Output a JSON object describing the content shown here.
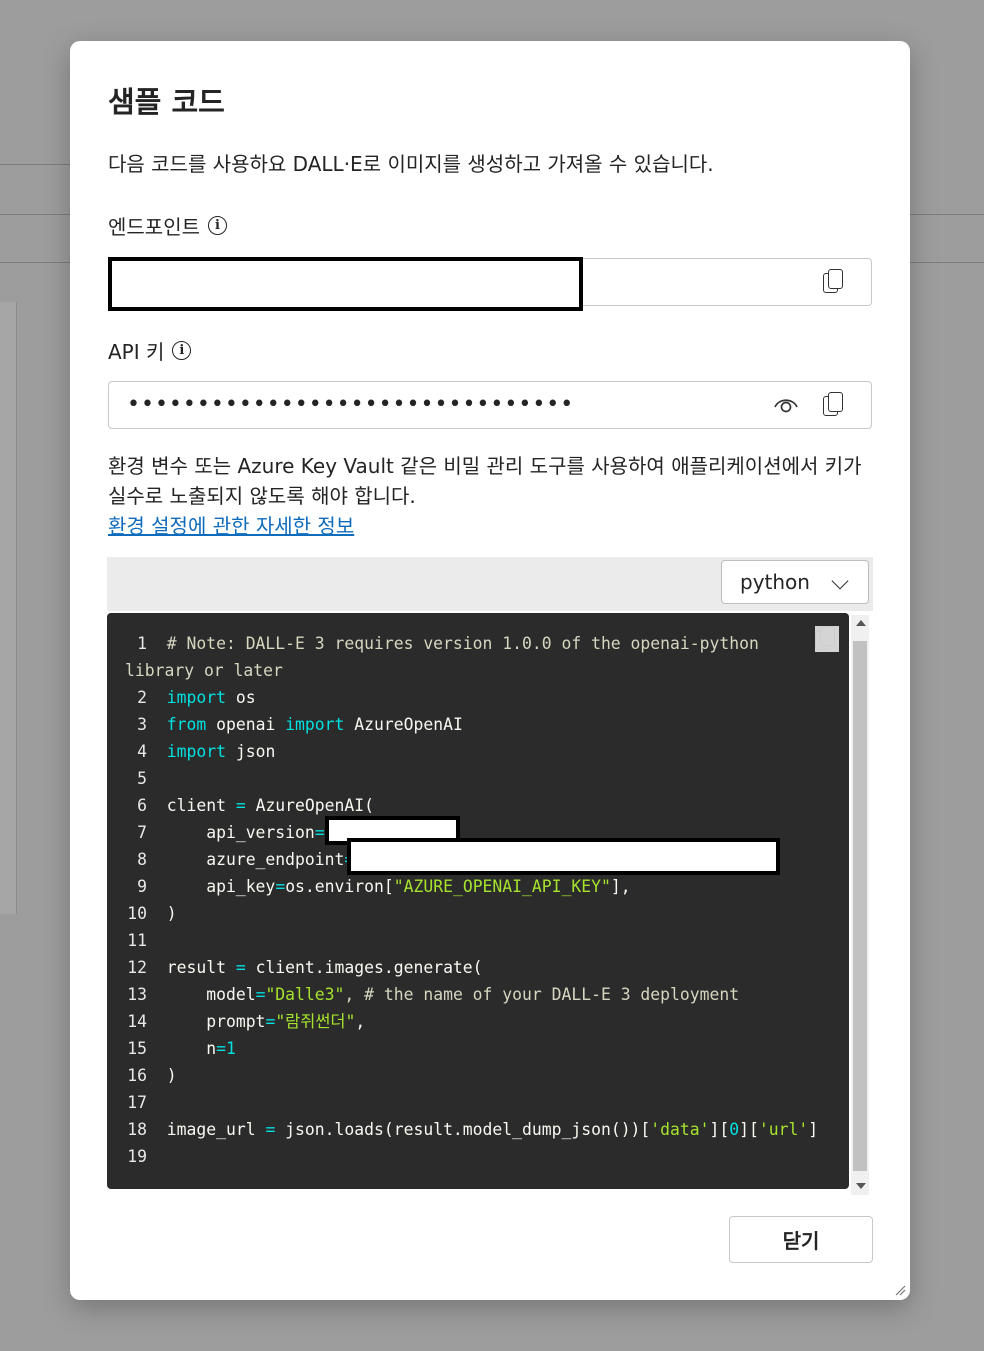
{
  "dialog": {
    "title": "샘플 코드",
    "description": "다음 코드를 사용하요 DALL·E로 이미지를 생성하고 가져올 수 있습니다.",
    "endpoint_label": "엔드포인트",
    "api_key_label": "API 키",
    "api_key_masked": "••••••••••••••••••••••••••••••••",
    "warning": "환경 변수 또는 Azure Key Vault 같은 비밀 관리 도구를 사용하여 애플리케이션에서 키가 실수로 노출되지 않도록 해야 합니다.",
    "link": "환경 설정에 관한 자세한 정보",
    "language": "python",
    "close_label": "닫기"
  },
  "code": {
    "line_numbers": [
      "1",
      "2",
      "3",
      "4",
      "5",
      "6",
      "7",
      "8",
      "9",
      "10",
      "11",
      "12",
      "13",
      "14",
      "15",
      "16",
      "17",
      "18",
      "19"
    ],
    "line1": "# Note: DALL-E 3 requires version 1.0.0 of the openai-python",
    "line1_cont": "library or later",
    "import": "import",
    "from": "from",
    "os": " os",
    "openai": " openai ",
    "azure_openai": " AzureOpenAI",
    "json": " json",
    "client_assign": "client ",
    "eq": "=",
    "azure_call": " AzureOpenAI(",
    "api_version": "    api_version",
    "azure_endpoint": "    azure_endpoint",
    "api_key": "    api_key",
    "os_environ": "os.environ[",
    "env_key": "\"AZURE_OPENAI_API_KEY\"",
    "close_bracket_comma": "],",
    "close_paren": ")",
    "comma": ",",
    "result_assign": "result ",
    "generate_call": " client.images.generate(",
    "model": "    model",
    "model_value": "\"Dalle3\"",
    "model_comment": ", # the name of your DALL-E 3 deployment",
    "prompt": "    prompt",
    "prompt_value": "\"람쥐썬더\"",
    "n": "    n",
    "n_value": "1",
    "image_url_assign": "image_url ",
    "json_loads": " json.loads(result.model_dump_json())[",
    "data_key": "'data'",
    "mid_bracket": "][",
    "index": "0",
    "url_key": "'url'",
    "end_bracket": "]"
  },
  "colors": {
    "keyword": "#00e0e0",
    "string": "#a6e22e",
    "link": "#0f6cbd",
    "code_bg": "#2b2b2b"
  },
  "icons": [
    "info-icon",
    "copy-icon",
    "eye-icon",
    "chevron-down-icon",
    "resize-grip-icon"
  ]
}
